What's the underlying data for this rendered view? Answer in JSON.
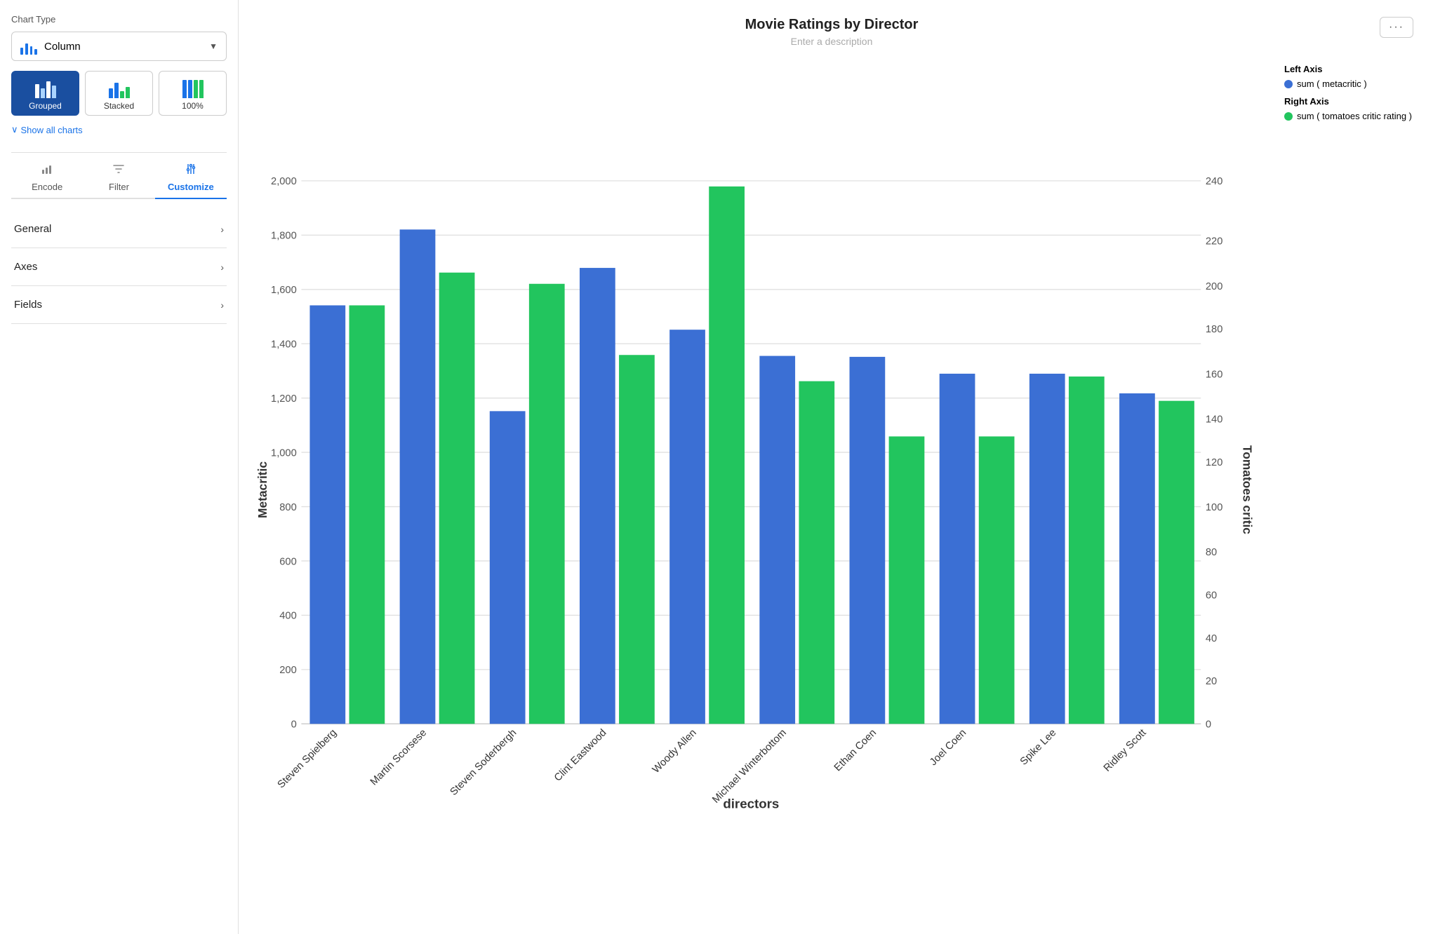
{
  "sidebar": {
    "chart_type_section": "Chart Type",
    "chart_type_label": "Column",
    "show_all_charts": "Show all charts",
    "tabs": [
      {
        "id": "encode",
        "label": "Encode",
        "icon": "📊"
      },
      {
        "id": "filter",
        "label": "Filter",
        "icon": "🔽"
      },
      {
        "id": "customize",
        "label": "Customize",
        "icon": "⚙"
      }
    ],
    "active_tab": "customize",
    "variants": [
      {
        "id": "grouped",
        "label": "Grouped",
        "active": true
      },
      {
        "id": "stacked",
        "label": "Stacked",
        "active": false
      },
      {
        "id": "100pct",
        "label": "100%",
        "active": false
      }
    ],
    "accordions": [
      {
        "id": "general",
        "label": "General"
      },
      {
        "id": "axes",
        "label": "Axes"
      },
      {
        "id": "fields",
        "label": "Fields"
      }
    ]
  },
  "chart": {
    "title": "Movie Ratings by Director",
    "subtitle": "Enter a description",
    "x_axis_label": "directors",
    "y_axis_left_label": "Metacritic",
    "y_axis_right_label": "Tomatoes critic",
    "more_button_label": "···",
    "directors": [
      "Steven Spielberg",
      "Martin Scorsese",
      "Steven Soderbergh",
      "Clint Eastwood",
      "Woody Allen",
      "Michael Winterbottom",
      "Ethan Coen",
      "Joel Coen",
      "Spike Lee",
      "Ridley Scott"
    ],
    "blue_values": [
      1540,
      1820,
      1150,
      1680,
      1450,
      1350,
      1350,
      1290,
      1290,
      1250,
      1220
    ],
    "green_values": [
      1540,
      1660,
      1620,
      1150,
      1360,
      1980,
      1260,
      1060,
      1060,
      1280,
      1190
    ],
    "left_y_max": 2000,
    "left_y_ticks": [
      0,
      200,
      400,
      600,
      800,
      1000,
      1200,
      1400,
      1600,
      1800,
      2000
    ],
    "right_y_max": 240,
    "right_y_ticks": [
      0,
      20,
      40,
      60,
      80,
      100,
      120,
      140,
      160,
      180,
      200,
      220,
      240
    ],
    "blue_color": "#3b6fd4",
    "green_color": "#22c55e",
    "legend": {
      "left_axis_title": "Left Axis",
      "left_axis_item": "sum ( metacritic )",
      "right_axis_title": "Right Axis",
      "right_axis_item": "sum ( tomatoes critic rating )"
    }
  }
}
